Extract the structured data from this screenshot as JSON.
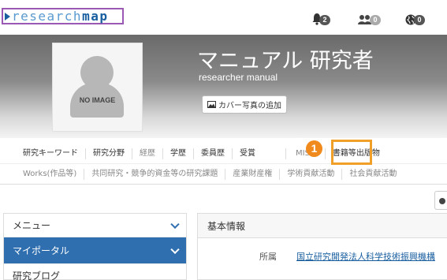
{
  "header": {
    "logo_prefix": "research",
    "logo_suffix": "map",
    "notifications": [
      {
        "icon": "bell-icon",
        "count": "2"
      },
      {
        "icon": "users-icon",
        "count": "0"
      },
      {
        "icon": "globe-icon",
        "count": "0"
      }
    ]
  },
  "profile": {
    "avatar_label": "NO IMAGE",
    "name_ja": "マニュアル 研究者",
    "name_en": "researcher manual",
    "cover_button": "カバー写真の追加"
  },
  "tabs": {
    "row1": [
      "研究キーワード",
      "研究分野",
      "経歴",
      "学歴",
      "委員歴",
      "受賞",
      "MISC",
      "書籍等出版物"
    ],
    "row2": [
      "Works(作品等)",
      "共同研究・競争的資金等の研究課題",
      "産業財産権",
      "学術貢献活動",
      "社会貢献活動"
    ]
  },
  "annotation": {
    "step_number": "1",
    "highlight_color": "#f0a028"
  },
  "sidebar": {
    "items": [
      {
        "label": "メニュー"
      },
      {
        "label": "マイポータル"
      },
      {
        "label": "研究ブログ"
      }
    ]
  },
  "main": {
    "title": "基本情報",
    "row_label": "所属",
    "row_value": "国立研究開発法人科学技術振興機構"
  },
  "colors": {
    "accent": "#2f6fb0",
    "logo_border": "#9b59b6"
  }
}
